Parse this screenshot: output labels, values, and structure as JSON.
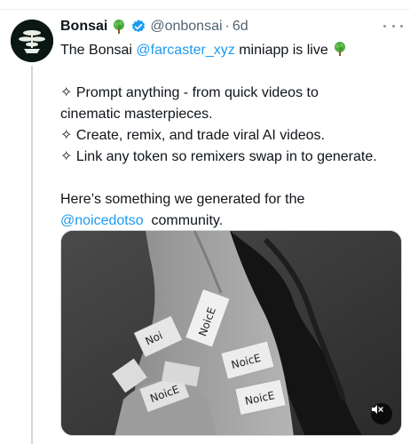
{
  "tweet": {
    "author_name": "Bonsai",
    "author_emoji_icon": "tree-emoji-icon",
    "verified_icon": "verified-badge-icon",
    "handle": "@onbonsai",
    "separator": "·",
    "time": "6d",
    "line1_text": "The Bonsai ",
    "line1_mention": "@farcaster_xyz",
    "line1_text_after": " miniapp is live ",
    "bullet1_a": "✧ Prompt anything - from quick videos to",
    "bullet1_b": "cinematic masterpieces.",
    "bullet2": "✧ Create, remix, and trade viral AI videos.",
    "bullet3": "✧ Link any token so remixers swap in to generate.",
    "para2_a": "Here’s something we generated for the",
    "para2_mention": "@noicedotso",
    "para2_after": "  community."
  },
  "media": {
    "card_text_1": "NoicE",
    "card_text_2": "NoicE",
    "card_text_3": "NoicE",
    "card_text_4": "NoicE",
    "card_text_5": "Noi",
    "mute_icon": "volume-mute-icon"
  },
  "colors": {
    "link": "#1d9bf0",
    "secondary": "#536471",
    "verified": "#1d9bf0",
    "avatar_bg": "#0b1712",
    "tree_green": "#4caf3e"
  }
}
